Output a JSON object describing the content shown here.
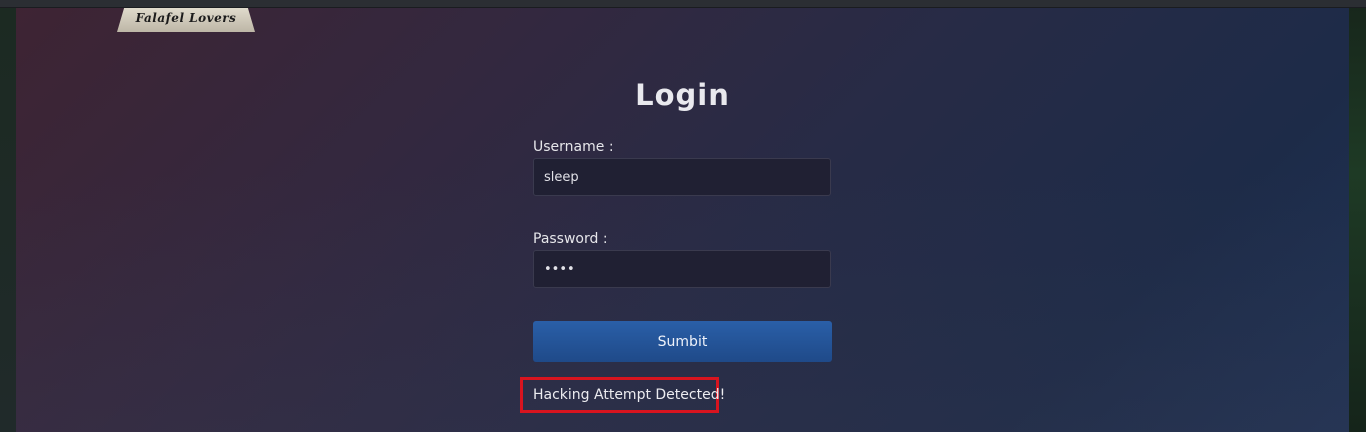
{
  "logo": {
    "text": "Falafel Lovers"
  },
  "login": {
    "title": "Login",
    "username_label": "Username :",
    "username_value": "sleep",
    "password_label": "Password :",
    "password_value": "••••",
    "submit_label": "Sumbit",
    "alert_text": "Hacking Attempt Detected!"
  },
  "colors": {
    "alert_border": "#d8141f",
    "button": "#2a5fa8",
    "logo_accent": "#f4a23a"
  }
}
